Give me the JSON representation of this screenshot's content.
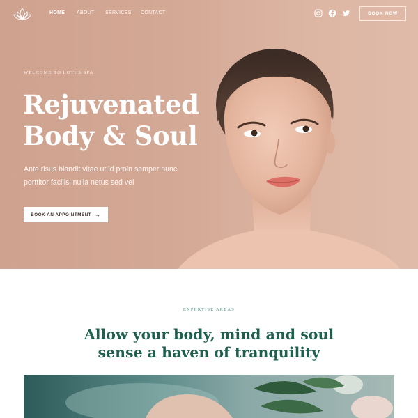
{
  "brand": {
    "name": "Lotus Spa",
    "logo_icon": "lotus-icon"
  },
  "nav": {
    "links": [
      {
        "label": "HOME",
        "active": true
      },
      {
        "label": "ABOUT",
        "active": false
      },
      {
        "label": "SERVICES",
        "active": false
      },
      {
        "label": "CONTACT",
        "active": false
      }
    ],
    "social": [
      "instagram-icon",
      "facebook-icon",
      "twitter-icon"
    ],
    "cta_label": "BOOK NOW"
  },
  "hero": {
    "eyebrow": "WELCOME TO LOTUS SPA",
    "headline_line1": "Rejuvenated",
    "headline_line2": "Body & Soul",
    "lead_line1": "Ante risus blandit vitae ut id proin semper nunc",
    "lead_line2": "porttitor facilisi nulla netus sed vel",
    "cta_label": "BOOK AN APPOINTMENT",
    "cta_arrow": "→"
  },
  "expertise": {
    "eyebrow": "EXPERTISE AREAS",
    "title_line1": "Allow your body, mind and soul",
    "title_line2": "sense a haven of tranquility"
  },
  "colors": {
    "hero_bg": "#d3a895",
    "accent_green": "#1e5f4e",
    "eyebrow_green": "#4f9a86"
  }
}
